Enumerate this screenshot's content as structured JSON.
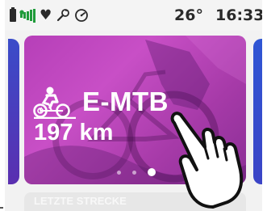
{
  "status_bar": {
    "temperature": "26°",
    "time": "16:33",
    "icons": [
      "battery-icon",
      "signal-icon",
      "heart-icon",
      "tool-icon",
      "gauge-icon"
    ]
  },
  "card": {
    "title": "E-MTB",
    "distance": "197 km",
    "icon": "emtb-rider-icon",
    "accent_color": "#b63fb8"
  },
  "pager": {
    "count": 3,
    "active_index": 3
  },
  "below_card": {
    "text": "LETZTE STRECKE"
  },
  "overlay": {
    "icon": "pointing-hand-icon"
  }
}
